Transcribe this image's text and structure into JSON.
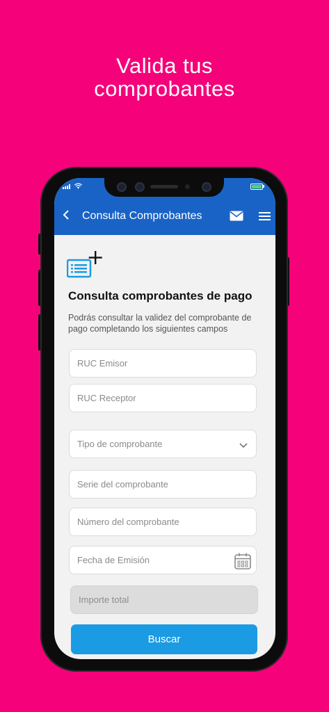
{
  "promo": {
    "title_line1": "Valida tus",
    "title_line2": "comprobantes"
  },
  "header": {
    "title": "Consulta Comprobantes",
    "back_icon": "chevron-left-icon",
    "mail_icon": "mail-icon",
    "menu_icon": "hamburger-menu-icon",
    "background": "#1A63C6"
  },
  "content": {
    "section_title": "Consulta comprobantes de pago",
    "description": "Podrás consultar la validez del comprobante de pago completando los siguientes campos"
  },
  "form": {
    "ruc_emisor_placeholder": "RUC Emisor",
    "ruc_receptor_placeholder": "RUC Receptor",
    "tipo_placeholder": "Tipo de comprobante",
    "serie_placeholder": "Serie del comprobante",
    "numero_placeholder": "Número del comprobante",
    "fecha_placeholder": "Fecha de Emisión",
    "importe_placeholder": "Importe total",
    "search_label": "Buscar"
  },
  "colors": {
    "background": "#F5027A",
    "accent": "#1A9BE3",
    "header": "#1A63C6"
  }
}
